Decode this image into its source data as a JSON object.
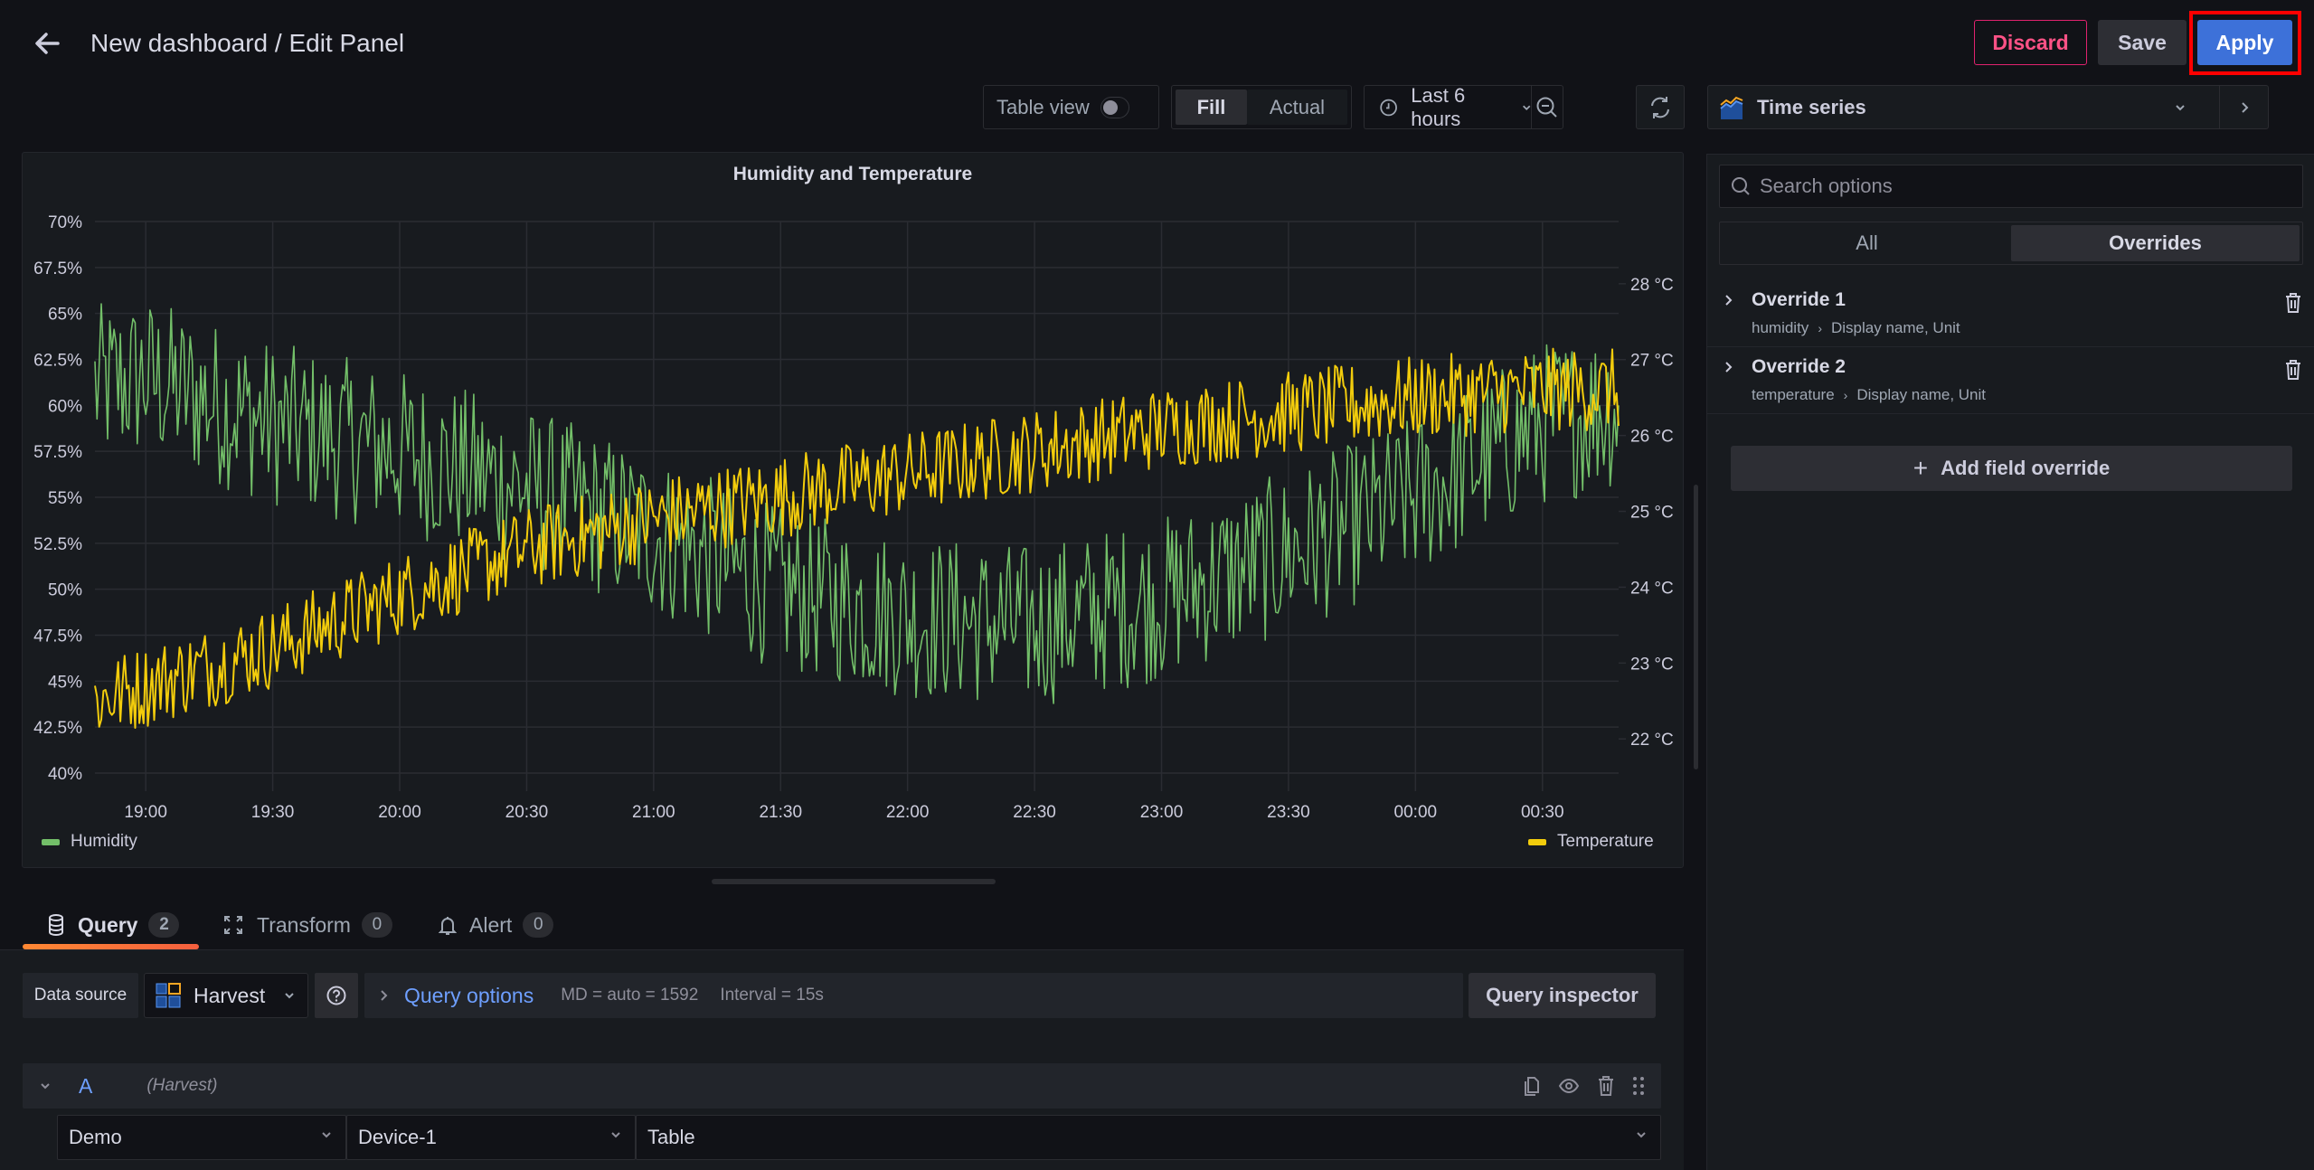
{
  "header": {
    "title": "New dashboard / Edit Panel",
    "discard_label": "Discard",
    "save_label": "Save",
    "apply_label": "Apply"
  },
  "toolbar": {
    "table_view_label": "Table view",
    "table_view_on": false,
    "fill_label": "Fill",
    "actual_label": "Actual",
    "fill_active": true,
    "time_range": "Last 6 hours",
    "visualization": "Time series"
  },
  "colors": {
    "humidity": "#73bf69",
    "temperature": "#f2cc0c",
    "accent_blue": "#3d71d9",
    "discard_red": "#ff5286",
    "tab_underline": "#ff8833",
    "link_blue": "#6e9fff"
  },
  "chart_data": {
    "type": "line",
    "title": "Humidity and Temperature",
    "x_ticks": [
      "19:00",
      "19:30",
      "20:00",
      "20:30",
      "21:00",
      "21:30",
      "22:00",
      "22:30",
      "23:00",
      "23:30",
      "00:00",
      "00:30"
    ],
    "x_range": [
      "18:48",
      "00:48"
    ],
    "grid": true,
    "legend_placement": "bottom",
    "y_left": {
      "label": "Humidity",
      "unit": "%",
      "ticks": [
        "40%",
        "42.5%",
        "45%",
        "47.5%",
        "50%",
        "52.5%",
        "55%",
        "57.5%",
        "60%",
        "62.5%",
        "65%",
        "67.5%",
        "70%"
      ],
      "range": [
        40,
        70
      ]
    },
    "y_right": {
      "label": "Temperature",
      "unit": "°C",
      "ticks": [
        "22 °C",
        "23 °C",
        "24 °C",
        "25 °C",
        "26 °C",
        "27 °C",
        "28 °C"
      ],
      "range": [
        21.55,
        28.82
      ]
    },
    "series": [
      {
        "name": "Humidity",
        "axis": "left",
        "trend_x": [
          "18:48",
          "19:00",
          "19:30",
          "20:00",
          "20:30",
          "21:00",
          "21:30",
          "22:00",
          "22:30",
          "23:00",
          "23:30",
          "00:00",
          "00:30",
          "00:48"
        ],
        "trend_y": [
          61,
          61.5,
          59,
          57.5,
          55.5,
          53,
          50,
          48.5,
          48,
          49.5,
          52,
          55,
          59,
          60
        ],
        "noise_amplitude": 4.5
      },
      {
        "name": "Temperature",
        "axis": "right",
        "trend_x": [
          "18:48",
          "19:00",
          "19:30",
          "20:00",
          "20:30",
          "21:00",
          "21:30",
          "22:00",
          "22:30",
          "23:00",
          "23:30",
          "00:00",
          "00:30",
          "00:48"
        ],
        "trend_y": [
          22.5,
          22.7,
          23.2,
          23.9,
          24.5,
          24.9,
          25.2,
          25.5,
          25.8,
          26.1,
          26.3,
          26.5,
          26.6,
          26.6
        ],
        "noise_amplitude": 0.55
      }
    ]
  },
  "query_tabs": [
    {
      "label": "Query",
      "count": "2"
    },
    {
      "label": "Transform",
      "count": "0"
    },
    {
      "label": "Alert",
      "count": "0"
    }
  ],
  "query": {
    "data_source_label": "Data source",
    "data_source": "Harvest",
    "query_options_label": "Query options",
    "md": "MD = auto = 1592",
    "interval": "Interval = 15s",
    "inspector_label": "Query inspector",
    "row": {
      "ref_id": "A",
      "ds_name": "(Harvest)",
      "selects": [
        "Demo",
        "Device-1",
        "Table"
      ]
    }
  },
  "options": {
    "search_placeholder": "Search options",
    "tabs": [
      "All",
      "Overrides"
    ],
    "active_tab": "Overrides",
    "overrides": [
      {
        "name": "Override 1",
        "field": "humidity",
        "properties": "Display name, Unit"
      },
      {
        "name": "Override 2",
        "field": "temperature",
        "properties": "Display name, Unit"
      }
    ],
    "add_label": "Add field override"
  }
}
